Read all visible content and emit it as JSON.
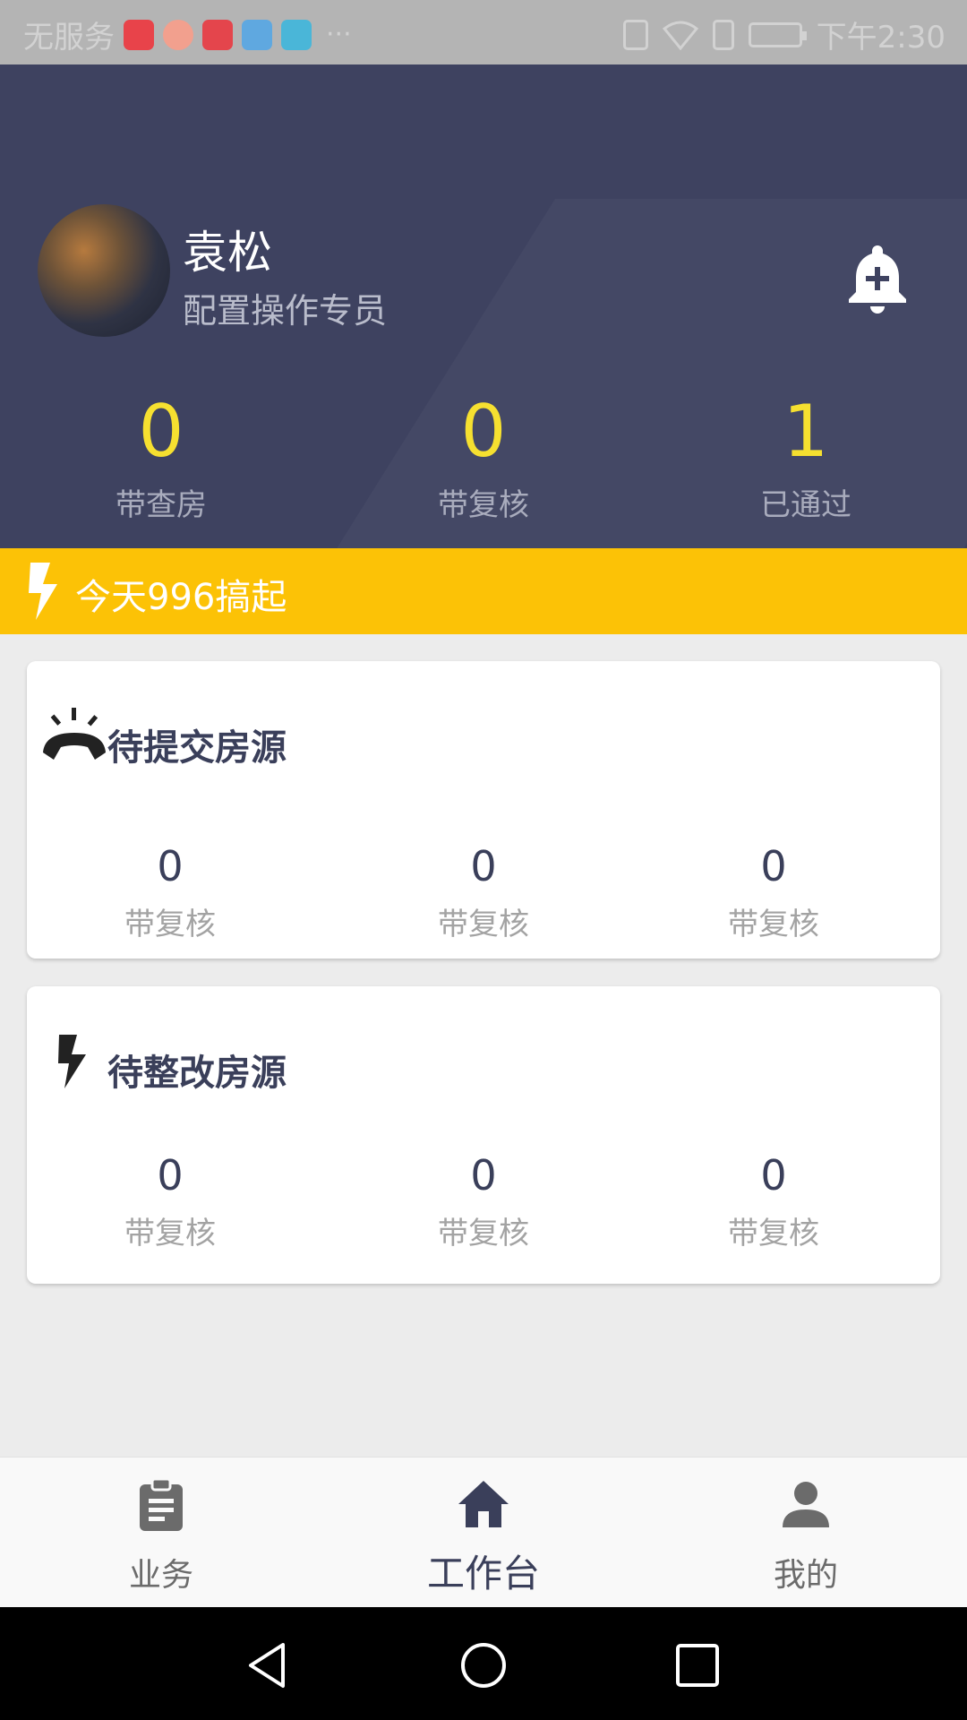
{
  "status_bar": {
    "carrier": "无服务",
    "time": "下午2:30",
    "app_icons": [
      "#e8434a",
      "#f27c6c",
      "#e4454c",
      "#5fa8e0",
      "#4ab6d8"
    ]
  },
  "header": {
    "user_name": "袁松",
    "user_role": "配置操作专员",
    "stats": [
      {
        "value": "0",
        "label": "带查房"
      },
      {
        "value": "0",
        "label": "带复核"
      },
      {
        "value": "1",
        "label": "已通过"
      }
    ],
    "bell_icon": "bell-plus-icon"
  },
  "banner": {
    "text": "今天996搞起",
    "icon": "lightning-icon"
  },
  "cards": [
    {
      "title": "待提交房源",
      "icon": "phone-ringing-icon",
      "stats": [
        {
          "value": "0",
          "label": "带复核"
        },
        {
          "value": "0",
          "label": "带复核"
        },
        {
          "value": "0",
          "label": "带复核"
        }
      ]
    },
    {
      "title": "待整改房源",
      "icon": "lightning-icon",
      "stats": [
        {
          "value": "0",
          "label": "带复核"
        },
        {
          "value": "0",
          "label": "带复核"
        },
        {
          "value": "0",
          "label": "带复核"
        }
      ]
    }
  ],
  "bottom_nav": {
    "items": [
      {
        "label": "业务",
        "icon": "clipboard-icon",
        "active": false
      },
      {
        "label": "工作台",
        "icon": "home-icon",
        "active": true
      },
      {
        "label": "我的",
        "icon": "person-icon",
        "active": false
      }
    ]
  },
  "colors": {
    "header_bg": "#3e4260",
    "accent_yellow": "#f6e030",
    "banner_bg": "#fcc206",
    "title_dark": "#3a3f5a"
  }
}
